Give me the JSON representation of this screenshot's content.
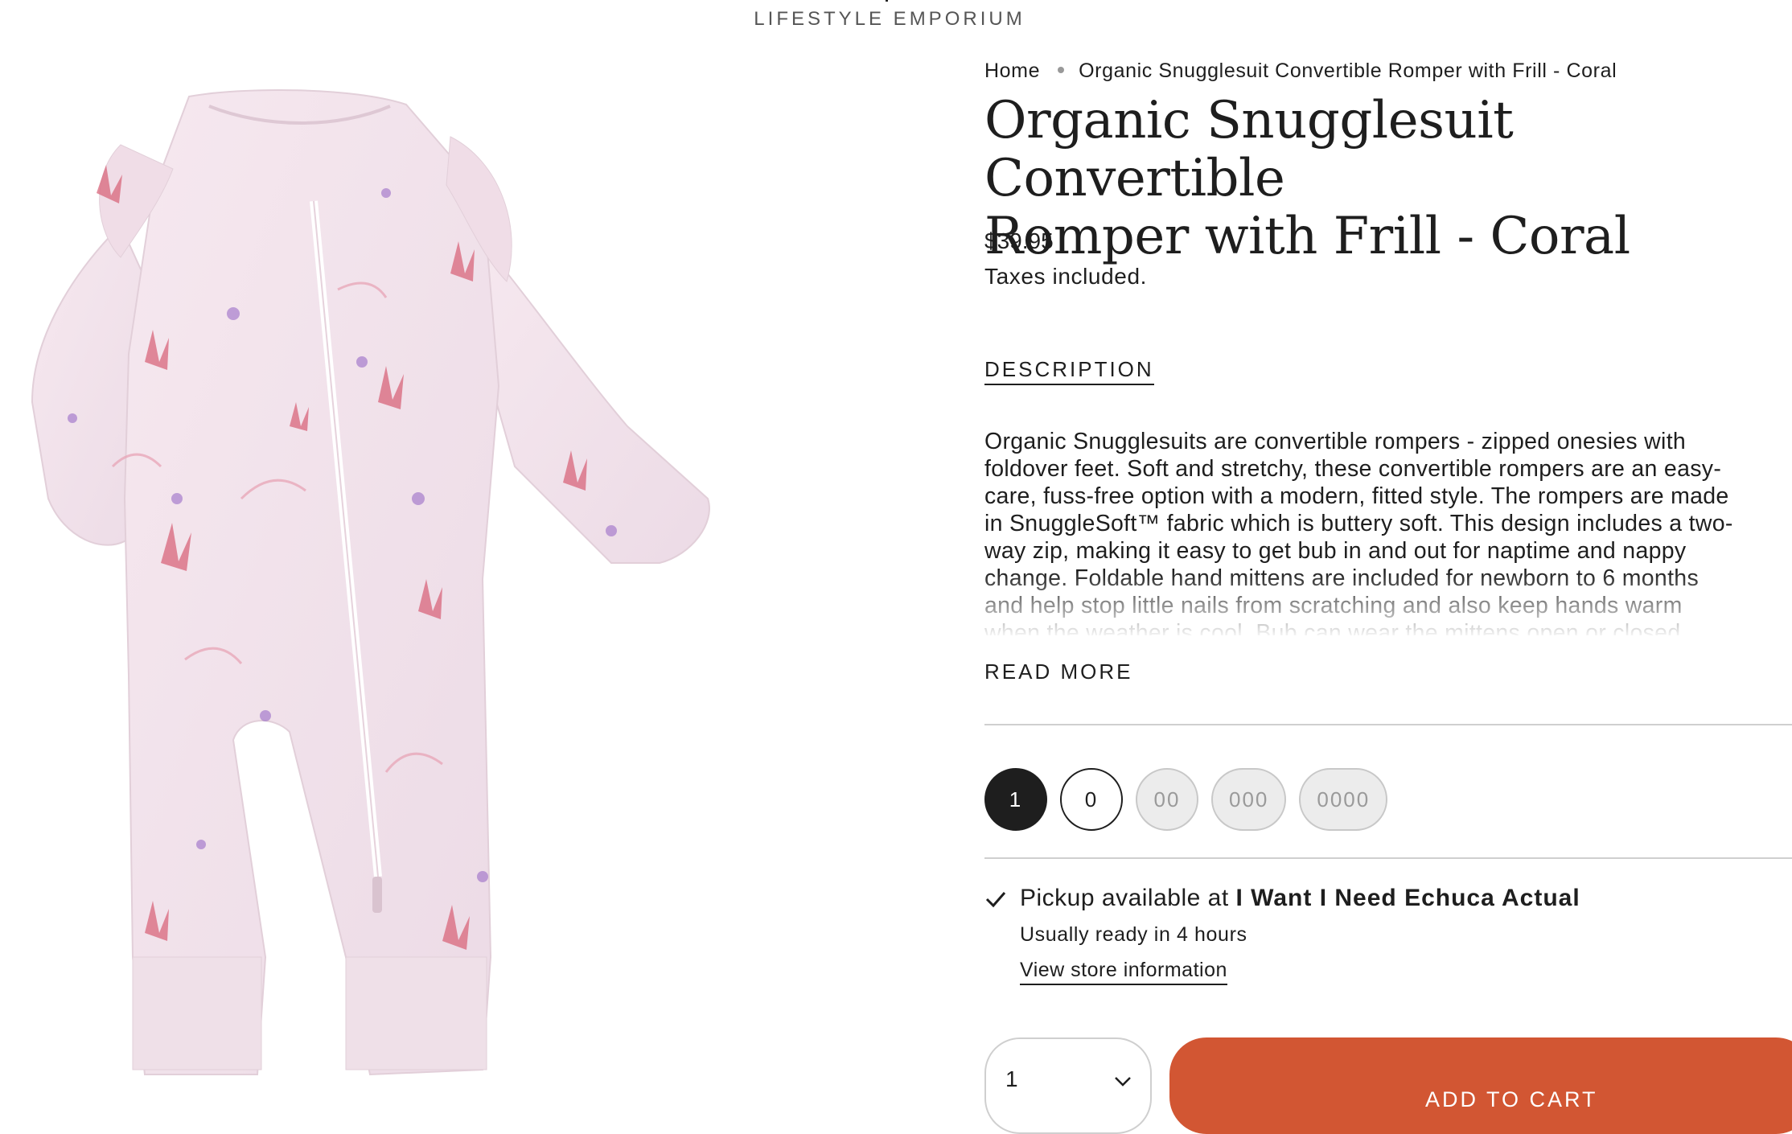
{
  "header": {
    "brand_subtitle": "LIFESTYLE EMPORIUM"
  },
  "breadcrumb": {
    "home": "Home",
    "current": "Organic Snugglesuit Convertible Romper with Frill - Coral"
  },
  "product": {
    "title_line1": "Organic Snugglesuit Convertible",
    "title_line2": "Romper with Frill - Coral",
    "price": "$39.95",
    "tax_note": "Taxes included.",
    "image_alt": "Organic Snugglesuit Convertible Romper with Frill - Coral"
  },
  "description": {
    "tab_label": "DESCRIPTION",
    "text": "Organic Snugglesuits are convertible rompers - zipped onesies with\nfoldover feet. Soft and stretchy, these convertible rompers are an easy-\ncare, fuss-free option with a modern, fitted style. The rompers are made\nin SnuggleSoft™ fabric which is buttery soft. This design includes a two-\nway zip, making it easy to get bub in and out for naptime and nappy\nchange. Foldable hand mittens are included for newborn to 6 months\nand help stop little nails from scratching and also keep hands warm\nwhen the weather is cool. Bub can wear the mittens open or closed.",
    "read_more": "READ MORE"
  },
  "sizes": [
    {
      "label": "1",
      "state": "selected"
    },
    {
      "label": "0",
      "state": "available"
    },
    {
      "label": "00",
      "state": "unavailable"
    },
    {
      "label": "000",
      "state": "unavailable"
    },
    {
      "label": "0000",
      "state": "unavailable"
    }
  ],
  "pickup": {
    "prefix": "Pickup available at ",
    "store": "I Want I Need Echuca Actual",
    "ready": "Usually ready in 4 hours",
    "link": "View store information"
  },
  "cart": {
    "quantity": "1",
    "add_label": "ADD TO CART"
  },
  "colors": {
    "accent": "#d25633",
    "text": "#1e1e1e",
    "romper": "#f3e4ec"
  },
  "icons": {
    "check": "check-icon",
    "chevron": "chevron-down-icon"
  }
}
